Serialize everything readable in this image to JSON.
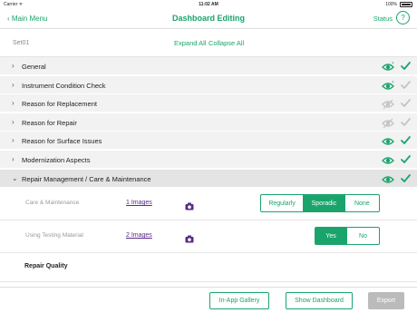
{
  "status_bar": {
    "carrier": "Carrier ᯤ",
    "time": "11:02 AM",
    "battery": "100%"
  },
  "nav": {
    "back_label": "‹ Main Menu",
    "title": "Dashboard Editing",
    "status_label": "Status"
  },
  "set": {
    "label": "Set01",
    "expand_all": "Expand All",
    "collapse_all": "Collapse All"
  },
  "sections": [
    {
      "name": "General",
      "eye": "eye-asterisk",
      "checked": true
    },
    {
      "name": "Instrument Condition Check",
      "eye": "eye-asterisk",
      "checked": false
    },
    {
      "name": "Reason for Replacement",
      "eye": "eye-hidden",
      "checked": false
    },
    {
      "name": "Reason for Repair",
      "eye": "eye-hidden",
      "checked": false
    },
    {
      "name": "Reason for Surface Issues",
      "eye": "eye",
      "checked": true
    },
    {
      "name": "Modernization Aspects",
      "eye": "eye",
      "checked": true
    },
    {
      "name": "Repair Management / Care & Maintenance",
      "eye": "eye",
      "checked": true
    }
  ],
  "items": [
    {
      "label": "Care & Maintenance",
      "images": "1 Images",
      "options": [
        "Regularly",
        "Sporadic",
        "None"
      ],
      "selected": "Sporadic"
    },
    {
      "label": "Using Testing Material",
      "images": "2 Images",
      "options": [
        "Yes",
        "No"
      ],
      "selected": "Yes"
    }
  ],
  "subheading": "Repair Quality",
  "footer": {
    "gallery": "In-App Gallery",
    "dashboard": "Show Dashboard",
    "export": "Export"
  },
  "colors": {
    "accent": "#1aa46c",
    "muted": "#c4c4c4",
    "link": "#5a2a8a"
  }
}
